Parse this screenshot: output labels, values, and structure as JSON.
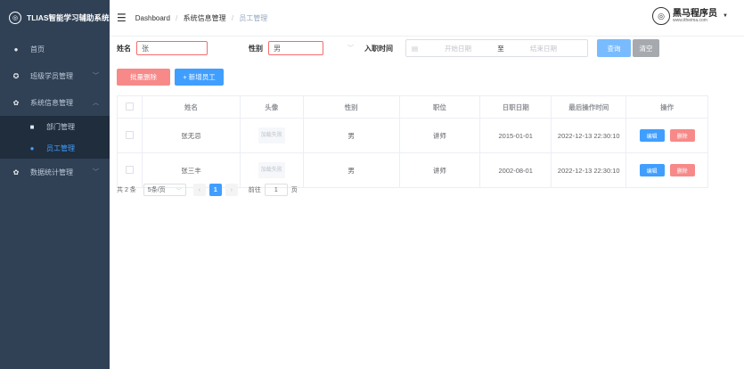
{
  "app": {
    "title": "TLIAS智能学习辅助系统"
  },
  "sidebar": {
    "items": [
      {
        "label": "首页",
        "icon": "home-icon"
      },
      {
        "label": "班级学员管理",
        "icon": "menu-icon"
      },
      {
        "label": "系统信息管理",
        "icon": "gear-icon",
        "children": [
          {
            "label": "部门管理",
            "icon": "grid-icon"
          },
          {
            "label": "员工管理",
            "icon": "user-icon"
          }
        ]
      },
      {
        "label": "数据统计管理",
        "icon": "gear-icon"
      }
    ]
  },
  "header": {
    "breadcrumb": [
      "Dashboard",
      "系统信息管理",
      "员工管理"
    ],
    "brand": {
      "name": "黑马程序员",
      "url": "www.itheima.com"
    }
  },
  "search": {
    "name_label": "姓名",
    "name_value": "张",
    "gender_label": "性别",
    "gender_value": "男",
    "date_label": "入职时间",
    "date_start_placeholder": "开始日期",
    "date_sep": "至",
    "date_end_placeholder": "结束日期",
    "query_button": "查询",
    "clear_button": "清空"
  },
  "actions": {
    "batch_delete": "批量删除",
    "add_employee": "+ 新增员工"
  },
  "table": {
    "headers": [
      "姓名",
      "头像",
      "性别",
      "职位",
      "日职日期",
      "最后操作时间",
      "操作"
    ],
    "image_placeholder": "加载失败",
    "edit_label": "编辑",
    "delete_label": "删除",
    "rows": [
      {
        "name": "张无忌",
        "gender": "男",
        "job": "讲师",
        "entry_date": "2015-01-01",
        "update_time": "2022-12-13 22:30:10"
      },
      {
        "name": "张三丰",
        "gender": "男",
        "job": "讲师",
        "entry_date": "2002-08-01",
        "update_time": "2022-12-13 22:30:10"
      }
    ]
  },
  "pagination": {
    "total": "共 2 条",
    "page_size": "5条/页",
    "current": "1",
    "goto_label": "前往",
    "goto_value": "1",
    "page_unit": "页"
  },
  "colors": {
    "sidebar": "#304156",
    "primary": "#409eff",
    "danger": "#f56c6c",
    "active_menu": "#409eff"
  }
}
